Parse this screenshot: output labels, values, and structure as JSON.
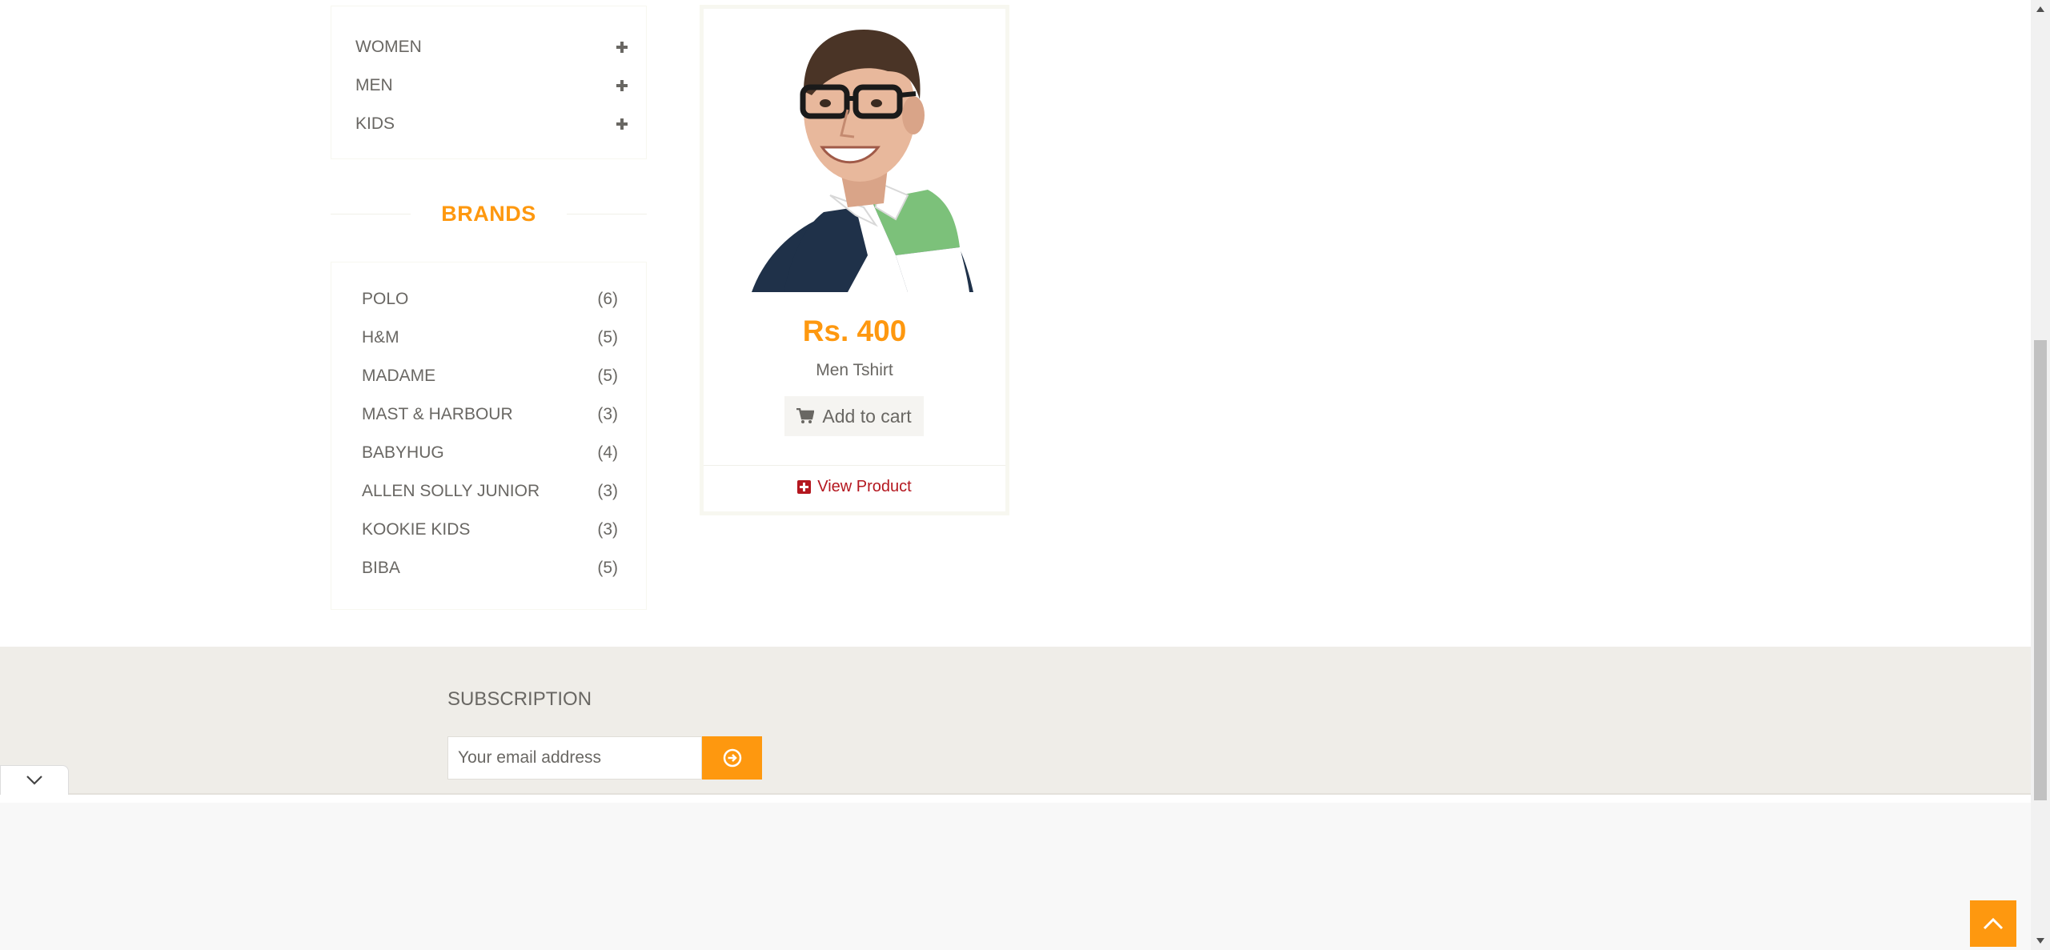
{
  "categories": [
    {
      "label": "WOMEN",
      "icon": "plus-icon"
    },
    {
      "label": "MEN",
      "icon": "plus-icon"
    },
    {
      "label": "KIDS",
      "icon": "plus-icon"
    }
  ],
  "brands": {
    "heading": "BRANDS",
    "items": [
      {
        "name": "POLO",
        "count": "(6)"
      },
      {
        "name": "H&M",
        "count": "(5)"
      },
      {
        "name": "MADAME",
        "count": "(5)"
      },
      {
        "name": "MAST & HARBOUR",
        "count": "(3)"
      },
      {
        "name": "BABYHUG",
        "count": "(4)"
      },
      {
        "name": "ALLEN SOLLY JUNIOR",
        "count": "(3)"
      },
      {
        "name": "KOOKIE KIDS",
        "count": "(3)"
      },
      {
        "name": "BIBA",
        "count": "(5)"
      }
    ]
  },
  "product": {
    "price": "Rs. 400",
    "name": "Men Tshirt",
    "add_to_cart": "Add to cart",
    "view_product": "View Product"
  },
  "footer": {
    "subscription_title": "SUBSCRIPTION",
    "email_placeholder": "Your email address"
  },
  "colors": {
    "accent": "#fe980f",
    "link": "#b4171f",
    "text": "#696763",
    "footer_bg": "#efede8"
  }
}
